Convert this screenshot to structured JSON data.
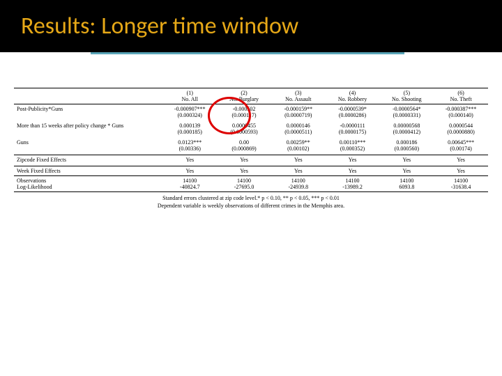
{
  "title": "Results:  Longer time window",
  "headers": {
    "c1n": "(1)",
    "c2n": "(2)",
    "c3n": "(3)",
    "c4n": "(4)",
    "c5n": "(5)",
    "c6n": "(6)",
    "c1": "No. All",
    "c2": "No. Burglary",
    "c3": "No. Assault",
    "c4": "No. Robbery",
    "c5": "No. Shooting",
    "c6": "No. Theft"
  },
  "rows": {
    "r1": {
      "label": "Post-Publicity*Guns",
      "v": [
        "-0.000907***",
        "-0.000502",
        "-0.000159**",
        "-0.0000539*",
        "-0.0000564*",
        "-0.000387***"
      ],
      "se": [
        "(0.000324)",
        "(0.000117)",
        "(0.0000719)",
        "(0.0000286)",
        "(0.0000331)",
        "(0.000140)"
      ]
    },
    "r2": {
      "label": "More than 15 weeks after policy change * Guns",
      "v": [
        "0.000139",
        "0.0000455",
        "0.0000146",
        "-0.0000111",
        "0.00000568",
        "0.0000544"
      ],
      "se": [
        "(0.000185)",
        "(0.0000593)",
        "(0.0000511)",
        "(0.0000175)",
        "(0.0000412)",
        "(0.0000880)"
      ]
    },
    "r3": {
      "label": "Guns",
      "v": [
        "0.0123***",
        "0.00",
        "0.00259**",
        "0.00110***",
        "0.000186",
        "0.00645***"
      ],
      "se": [
        "(0.00336)",
        "(0.000869)",
        "(0.00102)",
        "(0.000352)",
        "(0.000560)",
        "(0.00174)"
      ]
    },
    "zip": {
      "label": "Zipcode Fixed Effects",
      "v": [
        "Yes",
        "Yes",
        "Yes",
        "Yes",
        "Yes",
        "Yes"
      ]
    },
    "week": {
      "label": "Week Fixed Effects",
      "v": [
        "Yes",
        "Yes",
        "Yes",
        "Yes",
        "Yes",
        "Yes"
      ]
    },
    "obs": {
      "label": "Observations",
      "v": [
        "14100",
        "14100",
        "14100",
        "14100",
        "14100",
        "14100"
      ]
    },
    "ll": {
      "label": "Log-Likelihood",
      "v": [
        "-40824.7",
        "-27695.0",
        "-24939.8",
        "-13989.2",
        "6093.8",
        "-31638.4"
      ]
    }
  },
  "footer": {
    "l1": "Standard errors clustered at zip code level.* p < 0.10, ** p < 0.05, *** p < 0.01",
    "l2": "Dependent variable is weekly observations of different crimes in the Memphis area."
  }
}
